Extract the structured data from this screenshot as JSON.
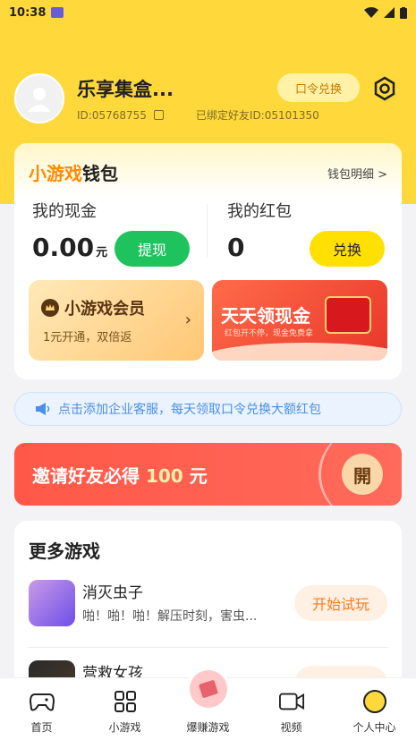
{
  "status_bar": {
    "time": "10:38"
  },
  "profile": {
    "nickname": "乐享集盒...",
    "id_text": "ID:05768755",
    "bound_text": "已绑定好友ID:05101350",
    "redeem_label": "口令兑换"
  },
  "wallet": {
    "title_part1": "小游戏",
    "title_part2": "钱包",
    "detail_link": "钱包明细 >",
    "cash": {
      "label": "我的现金",
      "amount": "0.00",
      "unit": "元",
      "button": "提现"
    },
    "redpacket": {
      "label": "我的红包",
      "amount": "0",
      "button": "兑换"
    },
    "vip": {
      "title": "小游戏会员",
      "subtitle": "1元开通，双倍返"
    },
    "cash_banner": {
      "title": "天天领现金",
      "subtitle": "红包开不停，现金免费拿"
    }
  },
  "notice": {
    "text": "点击添加企业客服，每天领取口令兑换大额红包"
  },
  "invite": {
    "text_prefix": "邀请好友必得",
    "amount": "100",
    "text_suffix": "元",
    "button": "開"
  },
  "more_games": {
    "title": "更多游戏",
    "items": [
      {
        "name": "消灭虫子",
        "desc": "啪！啪！啪！解压时刻，害虫...",
        "button": "开始试玩"
      },
      {
        "name": "营救女孩",
        "desc": "",
        "button": "开始试玩"
      }
    ]
  },
  "bottom_nav": {
    "items": [
      {
        "label": "首页"
      },
      {
        "label": "小游戏"
      },
      {
        "label": "爆赚游戏"
      },
      {
        "label": "视频"
      },
      {
        "label": "个人中心"
      }
    ]
  },
  "colors": {
    "brand_yellow": "#ffd93b",
    "green": "#1fc35d",
    "orange": "#ff7a1a",
    "red": "#ff5848"
  }
}
